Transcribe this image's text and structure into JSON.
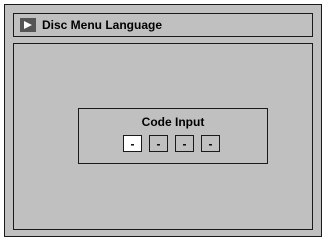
{
  "header": {
    "title": "Disc Menu Language",
    "icon": "play-icon"
  },
  "dialog": {
    "label": "Code Input",
    "digits": [
      "-",
      "-",
      "-",
      "-"
    ],
    "active_digit_index": 0
  },
  "colors": {
    "background": "#c0c0c0",
    "border": "#1a1a1a",
    "active_digit": "#ffffff",
    "icon": "#555555"
  }
}
